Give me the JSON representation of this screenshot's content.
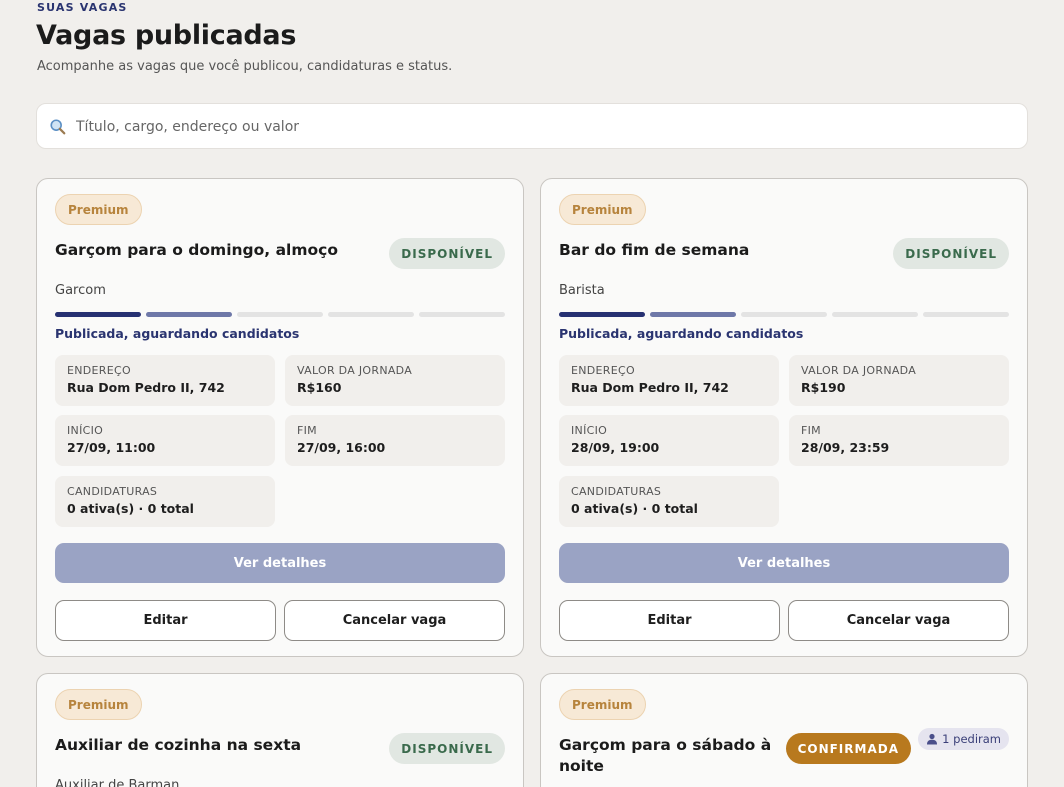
{
  "header": {
    "eyebrow": "SUAS VAGAS",
    "title": "Vagas publicadas",
    "subtitle": "Acompanhe as vagas que você publicou, candidaturas e status."
  },
  "search": {
    "placeholder": "Título, cargo, endereço ou valor",
    "value": ""
  },
  "colors": {
    "accent": "#263172",
    "premium": "#b7843d",
    "available": "#3a6a4c",
    "confirmed": "#b8791e"
  },
  "labels": {
    "address": "ENDEREÇO",
    "pay": "VALOR DA JORNADA",
    "start": "INÍCIO",
    "end": "FIM",
    "applications": "CANDIDATURAS",
    "details": "Ver detalhes",
    "edit": "Editar",
    "cancel": "Cancelar vaga"
  },
  "jobs": [
    {
      "badge": "Premium",
      "title": "Garçom para o domingo, almoço",
      "status": "DISPONÍVEL",
      "role": "Garcom",
      "progress_steps_done": 2,
      "progress_steps_total": 5,
      "step_text": "Publicada, aguardando candidatos",
      "address": "Rua Dom Pedro II, 742",
      "pay": "R$160",
      "start": "27/09, 11:00",
      "end": "27/09, 16:00",
      "applications": "0 ativa(s) · 0 total"
    },
    {
      "badge": "Premium",
      "title": "Bar do fim de semana",
      "status": "DISPONÍVEL",
      "role": "Barista",
      "progress_steps_done": 2,
      "progress_steps_total": 5,
      "step_text": "Publicada, aguardando candidatos",
      "address": "Rua Dom Pedro II, 742",
      "pay": "R$190",
      "start": "28/09, 19:00",
      "end": "28/09, 23:59",
      "applications": "0 ativa(s) · 0 total"
    },
    {
      "badge": "Premium",
      "title": "Auxiliar de cozinha na sexta",
      "status": "DISPONÍVEL",
      "role": "Auxiliar de Barman"
    },
    {
      "badge": "Premium",
      "title": "Garçom para o sábado à noite",
      "status": "CONFIRMADA",
      "requests": "1 pediram"
    }
  ]
}
